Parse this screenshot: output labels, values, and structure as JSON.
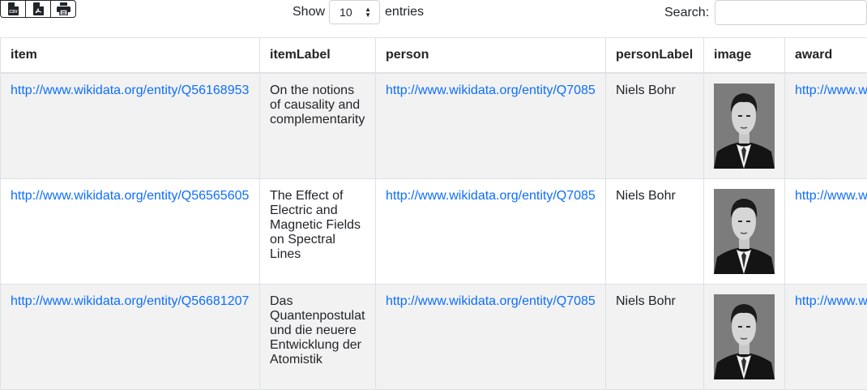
{
  "toolbar": {
    "export_buttons": [
      {
        "name": "csv-export-button",
        "icon": "csv-file-icon"
      },
      {
        "name": "pdf-export-button",
        "icon": "pdf-file-icon"
      },
      {
        "name": "print-button",
        "icon": "printer-icon"
      }
    ],
    "show_label": "Show",
    "page_length": "10",
    "entries_label": "entries",
    "search_label": "Search:",
    "search_value": ""
  },
  "table": {
    "columns": [
      "item",
      "itemLabel",
      "person",
      "personLabel",
      "image",
      "award"
    ],
    "rows": [
      {
        "item": "http://www.wikidata.org/entity/Q56168953",
        "itemLabel": "On the notions of causality and complementarity",
        "person": "http://www.wikidata.org/entity/Q7085",
        "personLabel": "Niels Bohr",
        "image": "portrait-photo",
        "award": "http://www.w"
      },
      {
        "item": "http://www.wikidata.org/entity/Q56565605",
        "itemLabel": "The Effect of Electric and Magnetic Fields on Spectral Lines",
        "person": "http://www.wikidata.org/entity/Q7085",
        "personLabel": "Niels Bohr",
        "image": "portrait-photo",
        "award": "http://www.w"
      },
      {
        "item": "http://www.wikidata.org/entity/Q56681207",
        "itemLabel": "Das Quantenpostulat und die neuere Entwicklung der Atomistik",
        "person": "http://www.wikidata.org/entity/Q7085",
        "personLabel": "Niels Bohr",
        "image": "portrait-photo",
        "award": "http://www.w"
      }
    ]
  },
  "colors": {
    "link": "#0d6efd",
    "stripe": "#f2f2f2",
    "border": "#dee2e6"
  }
}
